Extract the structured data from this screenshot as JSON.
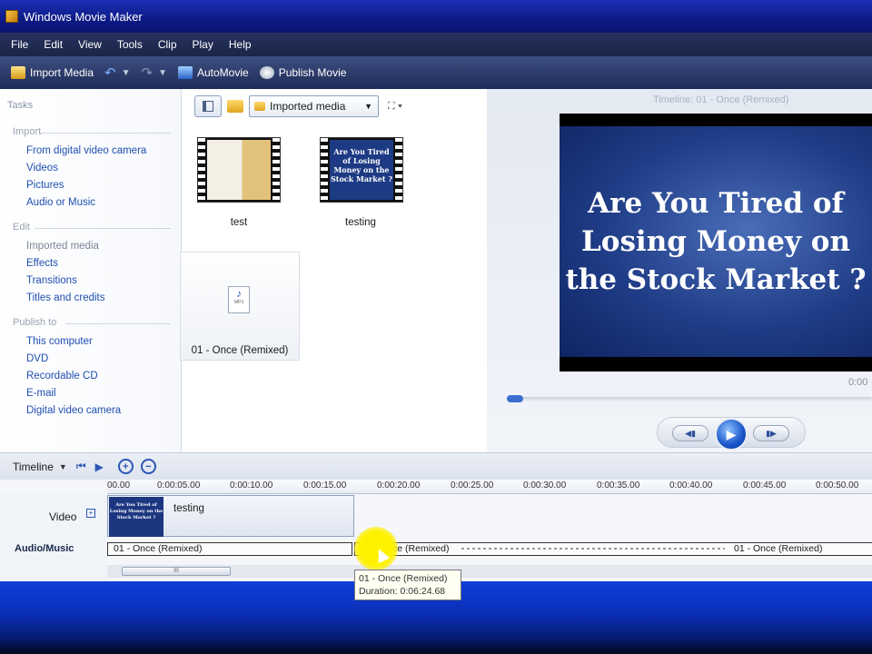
{
  "window": {
    "title": "Windows Movie Maker"
  },
  "menu": [
    "File",
    "Edit",
    "View",
    "Tools",
    "Clip",
    "Play",
    "Help"
  ],
  "toolbar": {
    "import": "Import Media",
    "automovie": "AutoMovie",
    "publish": "Publish Movie"
  },
  "tasks": {
    "heading": "Tasks",
    "import": {
      "label": "Import",
      "items": [
        "From digital video camera",
        "Videos",
        "Pictures",
        "Audio or Music"
      ]
    },
    "edit": {
      "label": "Edit",
      "items": [
        "Imported media",
        "Effects",
        "Transitions",
        "Titles and credits"
      ]
    },
    "publish": {
      "label": "Publish to",
      "items": [
        "This computer",
        "DVD",
        "Recordable CD",
        "E-mail",
        "Digital video camera"
      ]
    }
  },
  "collection": {
    "dropdown": "Imported media",
    "items": [
      {
        "name": "test"
      },
      {
        "name": "testing",
        "thumb_text": "Are You Tired of Losing Money on the Stock Market ?"
      },
      {
        "name": "01 - Once (Remixed)",
        "badge": "MP3"
      }
    ]
  },
  "preview": {
    "timeline_title": "Timeline: 01 - Once (Remixed)",
    "slide_text": "Are You Tired of Losing Money on the Stock Market ?",
    "time": "0:00"
  },
  "timeline": {
    "label": "Timeline",
    "ruler": [
      "00.00",
      "0:00:05.00",
      "0:00:10.00",
      "0:00:15.00",
      "0:00:20.00",
      "0:00:25.00",
      "0:00:30.00",
      "0:00:35.00",
      "0:00:40.00",
      "0:00:45.00",
      "0:00:50.00"
    ],
    "video_track": "Video",
    "audio_track": "Audio/Music",
    "video_clip": "testing",
    "audio_clips": [
      "01 - Once (Remixed)",
      "01 - Once (Remixed)",
      "01 - Once (Remixed)"
    ],
    "scroll_grip": "III"
  },
  "tooltip": {
    "line1": "01 - Once (Remixed)",
    "line2": "Duration: 0:06:24.68"
  }
}
